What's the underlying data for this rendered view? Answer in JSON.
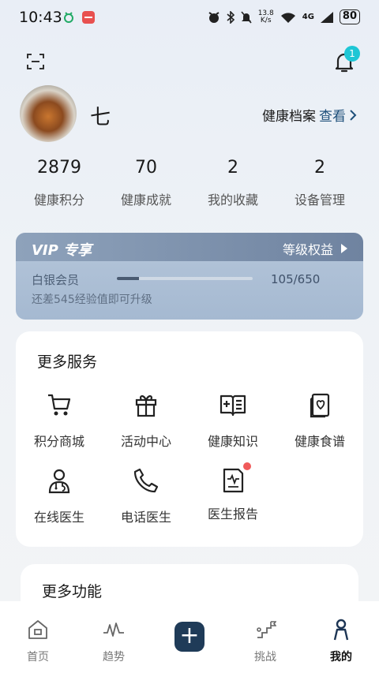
{
  "status_bar": {
    "time": "10:43",
    "net_speed_value": "13.8",
    "net_speed_unit": "K/s",
    "network": "4G",
    "battery": "80"
  },
  "profile": {
    "username": "七",
    "health_file_label": "健康档案",
    "health_file_link": "查看"
  },
  "stats": [
    {
      "value": "2879",
      "label": "健康积分"
    },
    {
      "value": "70",
      "label": "健康成就"
    },
    {
      "value": "2",
      "label": "我的收藏"
    },
    {
      "value": "2",
      "label": "设备管理"
    }
  ],
  "vip": {
    "title": "VIP 专享",
    "benefit_label": "等级权益",
    "level_name": "白银会员",
    "progress_text": "105/650",
    "progress_fraction": 0.16,
    "hint": "还差545经验值即可升级"
  },
  "services": {
    "title": "更多服务",
    "items": [
      {
        "label": "积分商城",
        "icon": "cart-icon"
      },
      {
        "label": "活动中心",
        "icon": "gift-icon"
      },
      {
        "label": "健康知识",
        "icon": "book-icon"
      },
      {
        "label": "健康食谱",
        "icon": "recipe-icon"
      },
      {
        "label": "在线医生",
        "icon": "doctor-icon"
      },
      {
        "label": "电话医生",
        "icon": "phone-icon"
      },
      {
        "label": "医生报告",
        "icon": "report-icon"
      }
    ]
  },
  "more_functions": {
    "title": "更多功能"
  },
  "bell": {
    "badge": "1"
  },
  "nav": {
    "items": [
      {
        "label": "首页",
        "icon": "home-icon"
      },
      {
        "label": "趋势",
        "icon": "trend-icon"
      },
      {
        "label": "",
        "icon": "plus-icon"
      },
      {
        "label": "挑战",
        "icon": "challenge-icon"
      },
      {
        "label": "我的",
        "icon": "person-icon"
      }
    ],
    "active_index": 4
  },
  "colors": {
    "accent": "#1d4f7a",
    "badge": "#1ec6d5",
    "nav_plus": "#1f3b58",
    "red_dot": "#f05a5a"
  }
}
